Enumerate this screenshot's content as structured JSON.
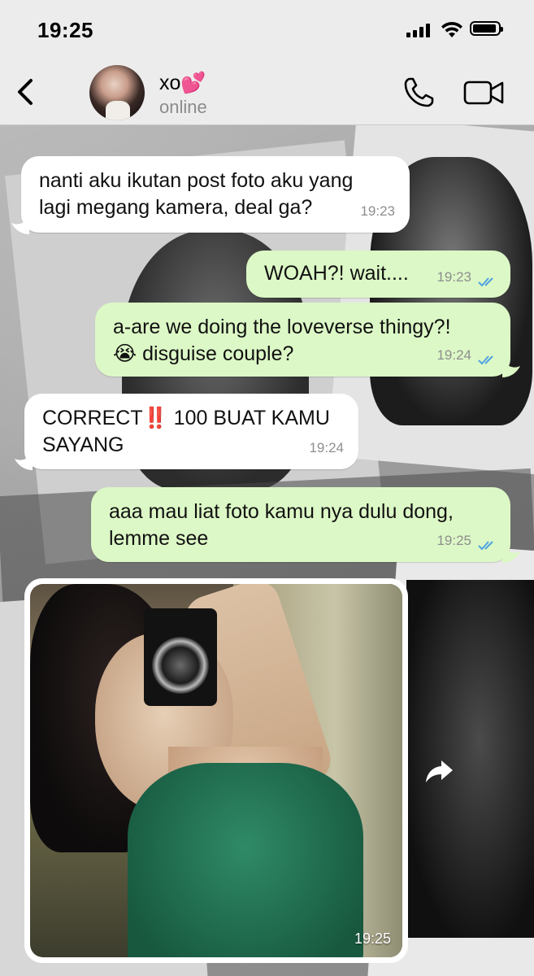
{
  "status_bar": {
    "time": "19:25"
  },
  "header": {
    "contact_name": "xo💕",
    "contact_status": "online"
  },
  "messages": [
    {
      "direction": "in",
      "text_line1": "nanti aku ikutan post foto aku yang",
      "text_line2": "lagi megang kamera, deal ga?",
      "time": "19:23"
    },
    {
      "direction": "out",
      "text_line1": "WOAH?! wait....",
      "time": "19:23",
      "status": "read"
    },
    {
      "direction": "out",
      "text_line1": "a-are we doing the loveverse thingy?!",
      "text_line2": "😭 disguise couple?",
      "time": "19:24",
      "status": "read"
    },
    {
      "direction": "in",
      "text_line1": "CORRECT‼️ 100 BUAT KAMU",
      "text_line2": "SAYANG",
      "time": "19:24"
    },
    {
      "direction": "out",
      "text_line1": "aaa mau liat foto kamu nya dulu dong,",
      "text_line2": "lemme see",
      "time": "19:25",
      "status": "read"
    },
    {
      "direction": "in",
      "type": "photo",
      "time": "19:25"
    }
  ],
  "icons": {
    "back": "chevron-left-icon",
    "call": "phone-icon",
    "video": "video-camera-icon",
    "forward": "forward-arrow-icon",
    "read_receipt": "double-check-icon"
  },
  "colors": {
    "incoming_bubble": "#ffffff",
    "outgoing_bubble": "#dcf8c6",
    "read_tick": "#4fa3e0",
    "header_bg": "#ececec"
  }
}
